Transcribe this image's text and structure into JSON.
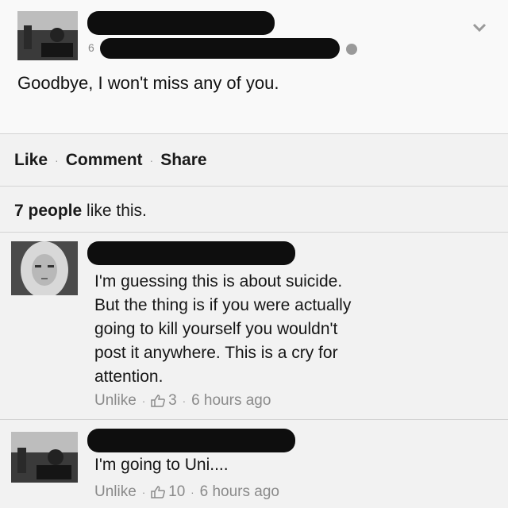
{
  "post": {
    "meta_digit": "6",
    "text": "Goodbye, I won't miss any of you."
  },
  "actions": {
    "like": "Like",
    "comment": "Comment",
    "share": "Share",
    "separator": "·"
  },
  "likes": {
    "count_text": "7 people",
    "suffix": " like this."
  },
  "comments": [
    {
      "lines": [
        "I'm guessing this is about suicide.",
        "But the thing is if you were actually",
        "going to kill yourself you wouldn't",
        "post it anywhere. This is a cry for",
        "attention."
      ],
      "unlike": "Unlike",
      "likes": "3",
      "time": "6 hours ago"
    },
    {
      "lines": [
        "I'm going to Uni...."
      ],
      "unlike": "Unlike",
      "likes": "10",
      "time": "6 hours ago"
    }
  ],
  "colors": {
    "background": "#f2f2f2",
    "redaction": "#0e0e0e",
    "muted_text": "#8a8a8a"
  },
  "icons": [
    "chevron-down-icon",
    "globe-icon",
    "thumbs-up-icon"
  ]
}
